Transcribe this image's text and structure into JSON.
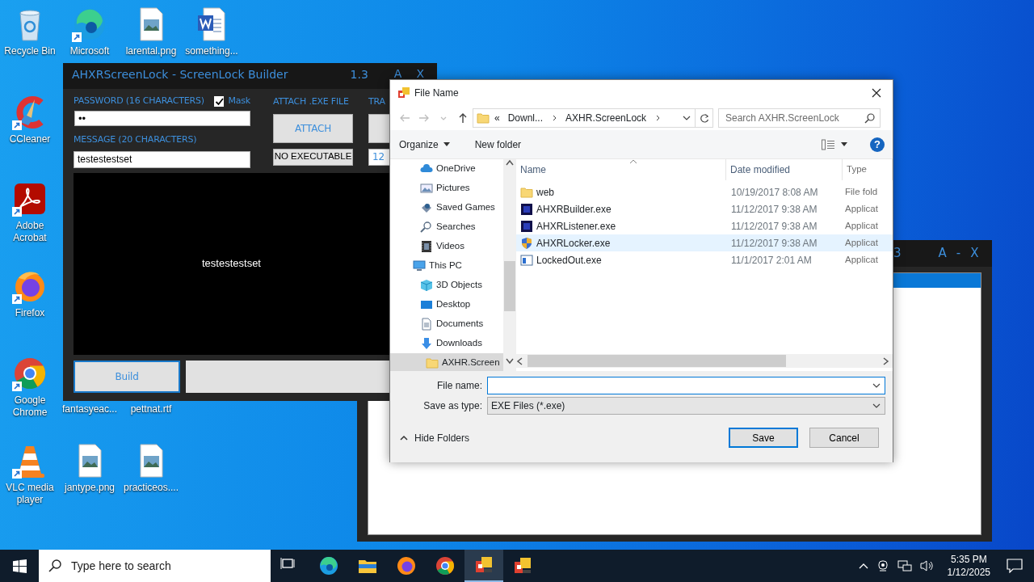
{
  "desktop_icons": [
    {
      "label": "Recycle Bin",
      "kind": "recycle"
    },
    {
      "label": "Microsoft",
      "kind": "edge"
    },
    {
      "label": "larental.png",
      "kind": "image"
    },
    {
      "label": "something...",
      "kind": "word"
    },
    {
      "label": "CCleaner",
      "kind": "ccleaner"
    },
    {
      "label": "Adobe Acrobat",
      "kind": "acrobat"
    },
    {
      "label": "Firefox",
      "kind": "firefox"
    },
    {
      "label": "Google Chrome",
      "kind": "chrome"
    },
    {
      "label": "fantasyeac...",
      "kind": "covered"
    },
    {
      "label": "pettnat.rtf",
      "kind": "covered"
    },
    {
      "label": "VLC media player",
      "kind": "vlc"
    },
    {
      "label": "jantype.png",
      "kind": "image"
    },
    {
      "label": "practiceos....",
      "kind": "image"
    }
  ],
  "back_window": {
    "title_fragment": "3",
    "controls": [
      "A",
      "-",
      "X"
    ]
  },
  "builder": {
    "title": "AHXRScreenLock - ScreenLock Builder",
    "version": "1.3",
    "controls": [
      "A",
      "X"
    ],
    "password_label": "PASSWORD (16 CHARACTERS)",
    "mask": {
      "label": "Mask",
      "checked": true
    },
    "password_value": "••",
    "message_label": "MESSAGE (20 CHARACTERS)",
    "message_value": "testestestset",
    "attach_label": "ATTACH .EXE FILE",
    "attach_button": "ATTACH",
    "attach_status": "NO EXECUTABLE",
    "column_3_label": "TRA",
    "column_3_value": "12",
    "preview_text": "testestestset",
    "build_button": "Build"
  },
  "dialog": {
    "title": "File Name",
    "address": [
      "«",
      "Downl...",
      "AXHR.ScreenLock"
    ],
    "search_placeholder": "Search AXHR.ScreenLock",
    "toolbar": {
      "organize": "Organize",
      "new_folder": "New folder",
      "help": "?"
    },
    "nav_tree": [
      {
        "children": [
          {
            "label": "OneDrive",
            "kind": "cloud",
            "selected": false
          },
          {
            "label": "Pictures",
            "kind": "pictures",
            "selected": false
          },
          {
            "label": "Saved Games",
            "kind": "games",
            "selected": false
          },
          {
            "label": "Searches",
            "kind": "search",
            "selected": false
          },
          {
            "label": "Videos",
            "kind": "videos",
            "selected": false
          }
        ]
      },
      {
        "label": "This PC",
        "kind": "pc",
        "selected": false,
        "children": [
          {
            "label": "3D Objects",
            "kind": "cube",
            "selected": false
          },
          {
            "label": "Desktop",
            "kind": "desktop",
            "selected": false
          },
          {
            "label": "Documents",
            "kind": "documents",
            "selected": false
          },
          {
            "label": "Downloads",
            "kind": "downloads",
            "selected": false,
            "children": [
              {
                "label": "AXHR.Screen",
                "kind": "folder",
                "selected": true
              }
            ]
          }
        ]
      }
    ],
    "columns": [
      "Name",
      "Date modified",
      "Type"
    ],
    "files": [
      {
        "name": "web",
        "kind": "folder",
        "date": "10/19/2017 8:08 AM",
        "type": "File fold",
        "selected": false
      },
      {
        "name": "AHXRBuilder.exe",
        "kind": "app",
        "date": "11/12/2017 9:38 AM",
        "type": "Applicat",
        "selected": false
      },
      {
        "name": "AHXRListener.exe",
        "kind": "app",
        "date": "11/12/2017 9:38 AM",
        "type": "Applicat",
        "selected": false
      },
      {
        "name": "AHXRLocker.exe",
        "kind": "shield",
        "date": "11/12/2017 9:38 AM",
        "type": "Applicat",
        "selected": true
      },
      {
        "name": "LockedOut.exe",
        "kind": "window",
        "date": "11/1/2017 2:01 AM",
        "type": "Applicat",
        "selected": false
      }
    ],
    "file_name_label": "File name:",
    "save_type_label": "Save as type:",
    "save_type_value": "EXE Files (*.exe)",
    "hide_folders": "Hide Folders",
    "save_button": "Save",
    "cancel_button": "Cancel"
  },
  "taskbar": {
    "search_placeholder": "Type here to search",
    "apps": [
      {
        "kind": "taskview",
        "selected": false
      },
      {
        "kind": "edge",
        "selected": false
      },
      {
        "kind": "explorer",
        "selected": false
      },
      {
        "kind": "firefox",
        "selected": false
      },
      {
        "kind": "chrome",
        "selected": false
      },
      {
        "kind": "tool",
        "selected": true
      },
      {
        "kind": "tool",
        "selected": false
      }
    ],
    "time": "5:35 PM",
    "date": "1/12/2025"
  }
}
